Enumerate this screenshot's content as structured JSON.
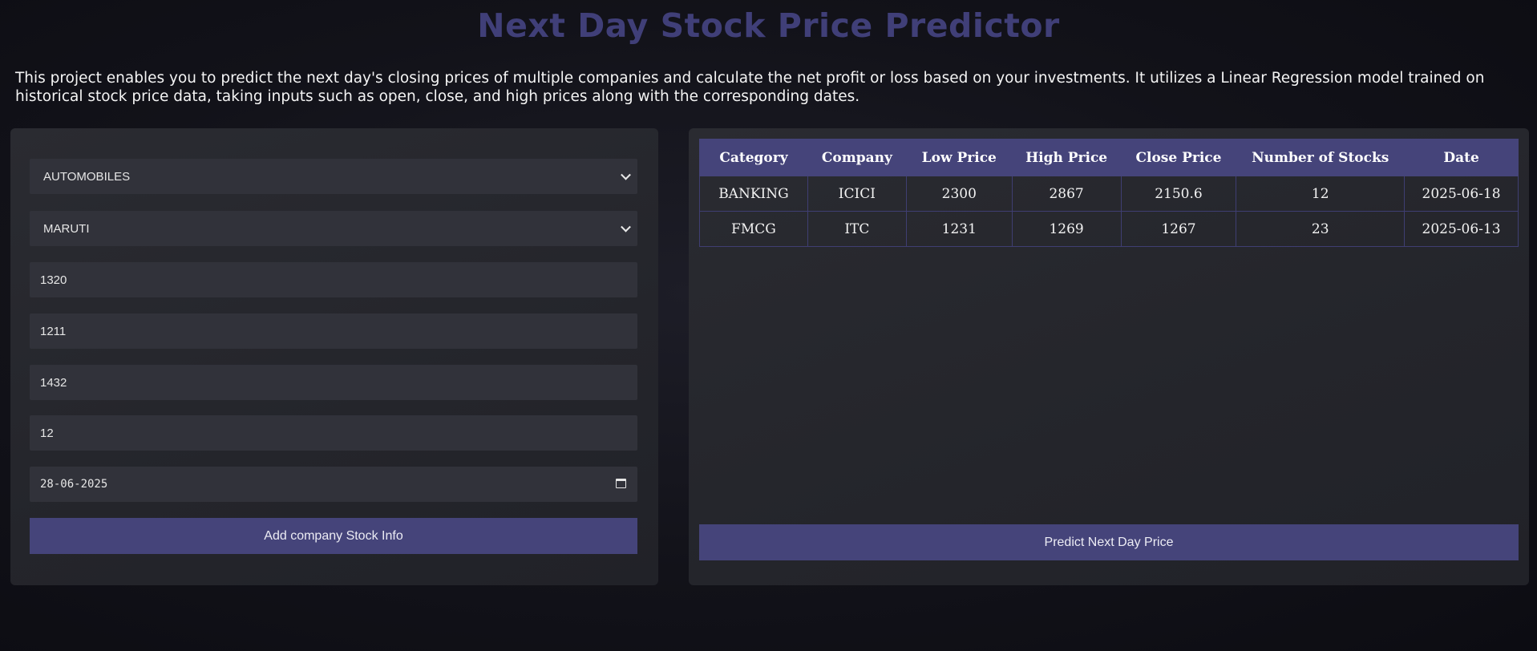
{
  "header": {
    "title": "Next Day Stock Price Predictor",
    "description": "This project enables you to predict the next day's closing prices of multiple companies and calculate the net profit or loss based on your investments. It utilizes a Linear Regression model trained on historical stock price data, taking inputs such as open, close, and high prices along with the corresponding dates."
  },
  "form": {
    "category_selected": "AUTOMOBILES",
    "company_selected": "MARUTI",
    "low_price_value": "1320",
    "high_price_value": "1211",
    "close_price_value": "1432",
    "num_stocks_value": "12",
    "date_value": "28-06-2025",
    "add_button_label": "Add company Stock Info"
  },
  "table": {
    "headers": [
      "Category",
      "Company",
      "Low Price",
      "High Price",
      "Close Price",
      "Number of Stocks",
      "Date"
    ],
    "rows": [
      [
        "BANKING",
        "ICICI",
        "2300",
        "2867",
        "2150.6",
        "12",
        "2025-06-18"
      ],
      [
        "FMCG",
        "ITC",
        "1231",
        "1269",
        "1267",
        "23",
        "2025-06-13"
      ]
    ]
  },
  "predict_button_label": "Predict Next Day Price",
  "icons": {
    "select_arrow": "chevron-down-icon",
    "date_picker": "calendar-icon"
  },
  "colors": {
    "accent": "#45447a",
    "title": "#403f78",
    "panel": "#26272d",
    "field": "#31323a"
  }
}
